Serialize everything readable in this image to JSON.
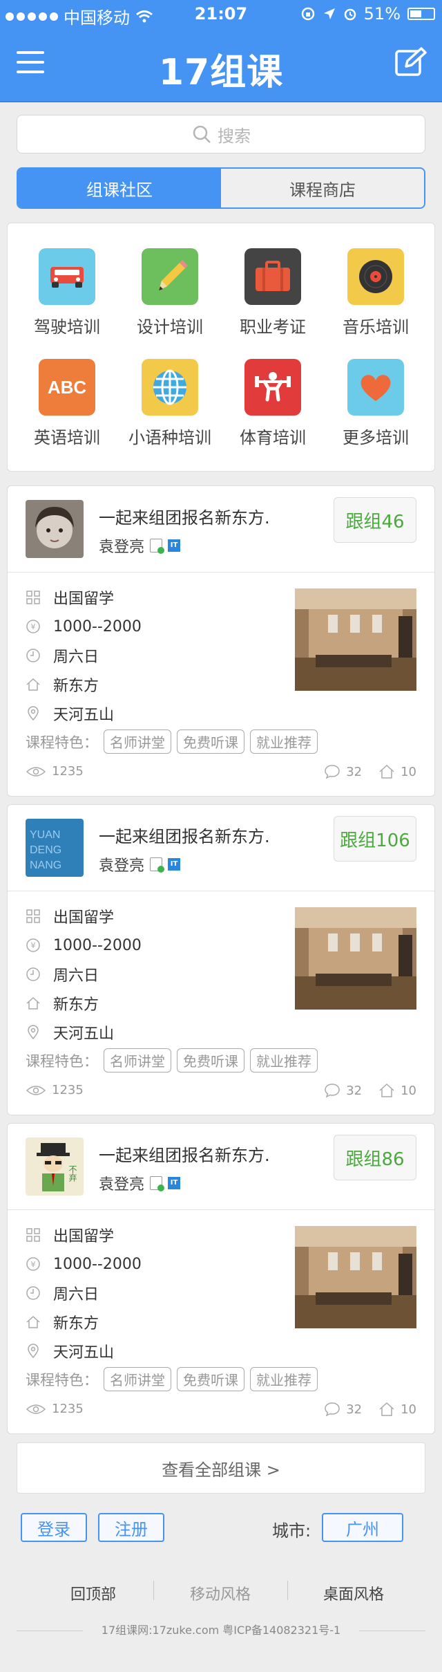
{
  "status_bar": {
    "carrier": "中国移动",
    "time": "21:07",
    "battery": "51%"
  },
  "header": {
    "title": "17组课",
    "menu_icon": "menu-icon",
    "edit_icon": "edit-icon"
  },
  "search": {
    "placeholder": "搜索"
  },
  "tabs": [
    {
      "label": "组课社区",
      "active": true
    },
    {
      "label": "课程商店",
      "active": false
    }
  ],
  "categories": [
    {
      "label": "驾驶培训",
      "icon": "car-icon",
      "color": "#6ccbe8"
    },
    {
      "label": "设计培训",
      "icon": "pencil-icon",
      "color": "#6cbf5c"
    },
    {
      "label": "职业考证",
      "icon": "briefcase-icon",
      "color": "#444444"
    },
    {
      "label": "音乐培训",
      "icon": "vinyl-record-icon",
      "color": "#f3c94a"
    },
    {
      "label": "英语培训",
      "icon": "abc-icon",
      "color": "#ee7c3b"
    },
    {
      "label": "小语种培训",
      "icon": "globe-icon",
      "color": "#f3c94a"
    },
    {
      "label": "体育培训",
      "icon": "weightlifter-icon",
      "color": "#e23b3b"
    },
    {
      "label": "更多培训",
      "icon": "heart-icon",
      "color": "#6ccbe8"
    }
  ],
  "groups": [
    {
      "title": "一起来组团报名新东方.",
      "user": "袁登亮",
      "badge_it": "IT",
      "follow": "跟组46",
      "category": "出国留学",
      "price": "1000--2000",
      "day": "周六日",
      "school": "新东方",
      "location": "天河五山",
      "features_label": "课程特色：",
      "tags": [
        "名师讲堂",
        "免费听课",
        "就业推荐"
      ],
      "views": "1235",
      "comments": "32",
      "likes": "10",
      "avatar": "child-portrait"
    },
    {
      "title": "一起来组团报名新东方.",
      "user": "袁登亮",
      "badge_it": "IT",
      "follow": "跟组106",
      "category": "出国留学",
      "price": "1000--2000",
      "day": "周六日",
      "school": "新东方",
      "location": "天河五山",
      "features_label": "课程特色：",
      "tags": [
        "名师讲堂",
        "免费听课",
        "就业推荐"
      ],
      "views": "1235",
      "comments": "32",
      "likes": "10",
      "avatar": "yuan-deng-nang",
      "avatar_text": [
        "YUAN",
        "DENG",
        "NANG"
      ]
    },
    {
      "title": "一起来组团报名新东方.",
      "user": "袁登亮",
      "badge_it": "IT",
      "follow": "跟组86",
      "category": "出国留学",
      "price": "1000--2000",
      "day": "周六日",
      "school": "新东方",
      "location": "天河五山",
      "features_label": "课程特色：",
      "tags": [
        "名师讲堂",
        "免费听课",
        "就业推荐"
      ],
      "views": "1235",
      "comments": "32",
      "likes": "10",
      "avatar": "cartoon-man",
      "avatar_text": "不弃"
    }
  ],
  "view_all": "查看全部组课 >",
  "footer": {
    "login": "登录",
    "register": "注册",
    "city_label": "城市:",
    "city": "广州",
    "links": [
      "回顶部",
      "移动风格",
      "桌面风格"
    ],
    "copyright": "17组课网:17zuke.com 粤ICP备14082321号-1"
  },
  "colors": {
    "primary": "#4593f3",
    "follow_green": "#4aaa3c",
    "background": "#ededed"
  }
}
